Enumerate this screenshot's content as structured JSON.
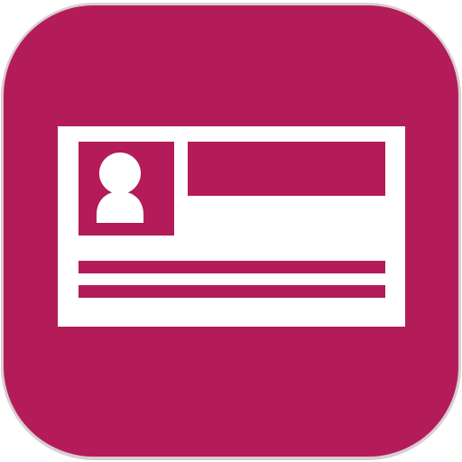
{
  "app_icon": {
    "icon_name": "id-card-icon",
    "colors": {
      "tile_background": "#B31C58",
      "tile_edge_highlight": "#D9CDD3",
      "card_face": "#FFFFFF",
      "card_details": "#B31C58"
    },
    "elements": [
      "rounded-square-tile",
      "id-card",
      "photo-box",
      "person-silhouette",
      "name-bar",
      "detail-line-1",
      "detail-line-2"
    ]
  }
}
